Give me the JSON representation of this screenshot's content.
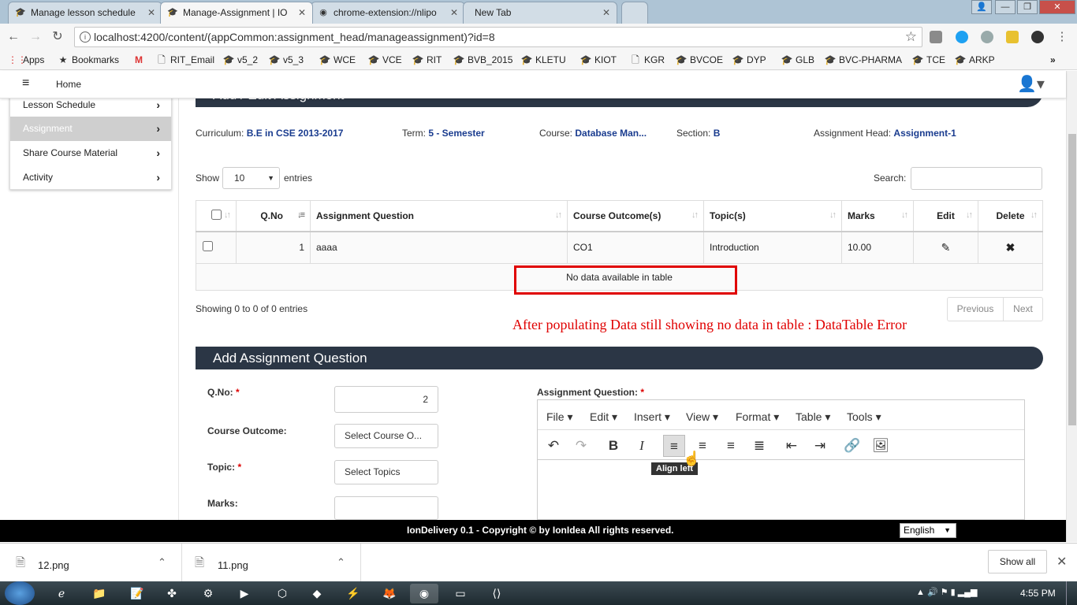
{
  "browser": {
    "tabs": [
      {
        "title": "Manage lesson schedule",
        "icon": "graduation-cap-icon"
      },
      {
        "title": "Manage-Assignment | IO",
        "icon": "graduation-cap-icon"
      },
      {
        "title": "chrome-extension://nlipo",
        "icon": "chrome-icon"
      },
      {
        "title": "New Tab",
        "icon": ""
      }
    ],
    "url": "localhost:4200/content/(appCommon:assignment_head/manageassignment)?id=8",
    "bookmarks": [
      "Apps",
      "Bookmarks",
      "RIT_Email",
      "v5_2",
      "v5_3",
      "WCE",
      "VCE",
      "RIT",
      "BVB_2015",
      "KLETU",
      "KIOT",
      "KGR",
      "BVCOE",
      "DYP",
      "GLB",
      "BVC-PHARMA",
      "TCE",
      "ARKP"
    ],
    "overflow": "»"
  },
  "app": {
    "menu_icon": "≡",
    "home": "Home",
    "sidebar": [
      {
        "label": "Lesson Schedule",
        "active": false
      },
      {
        "label": "Assignment",
        "active": true
      },
      {
        "label": "Share Course Material",
        "active": false
      },
      {
        "label": "Activity",
        "active": false
      }
    ],
    "section_title": "Add / Edit Assignment",
    "info": {
      "curriculum_label": "Curriculum:",
      "curriculum": "B.E in CSE 2013-2017",
      "term_label": "Term:",
      "term": "5 - Semester",
      "course_label": "Course:",
      "course": "Database Man...",
      "section_label": "Section:",
      "section": "B",
      "head_label": "Assignment Head:",
      "head": "Assignment-1"
    },
    "table": {
      "show": "Show",
      "entries_value": "10",
      "entries": "entries",
      "search": "Search:",
      "columns": [
        "",
        "Q.No",
        "Assignment Question",
        "Course Outcome(s)",
        "Topic(s)",
        "Marks",
        "Edit",
        "Delete"
      ],
      "row": {
        "qno": "1",
        "question": "aaaa",
        "co": "CO1",
        "topic": "Introduction",
        "marks": "10.00"
      },
      "empty": "No data available in table",
      "info": "Showing 0 to 0 of 0 entries",
      "previous": "Previous",
      "next": "Next"
    },
    "annotation": "After populating Data still showing no data in table : DataTable Error",
    "form": {
      "title": "Add Assignment Question",
      "qno_label": "Q.No:",
      "qno_value": "2",
      "co_label": "Course Outcome:",
      "co_placeholder": "Select Course O...",
      "topic_label": "Topic:",
      "topic_placeholder": "Select Topics",
      "marks_label": "Marks:",
      "question_label": "Assignment Question:",
      "editor_menus": [
        "File",
        "Edit",
        "Insert",
        "View",
        "Format",
        "Table",
        "Tools"
      ],
      "tooltip": "Align left"
    },
    "footer": "IonDelivery 0.1 - Copyright © by IonIdea All rights reserved.",
    "language": "English"
  },
  "downloads": [
    {
      "name": "12.png"
    },
    {
      "name": "11.png"
    }
  ],
  "show_all": "Show all",
  "clock": "4:55 PM"
}
